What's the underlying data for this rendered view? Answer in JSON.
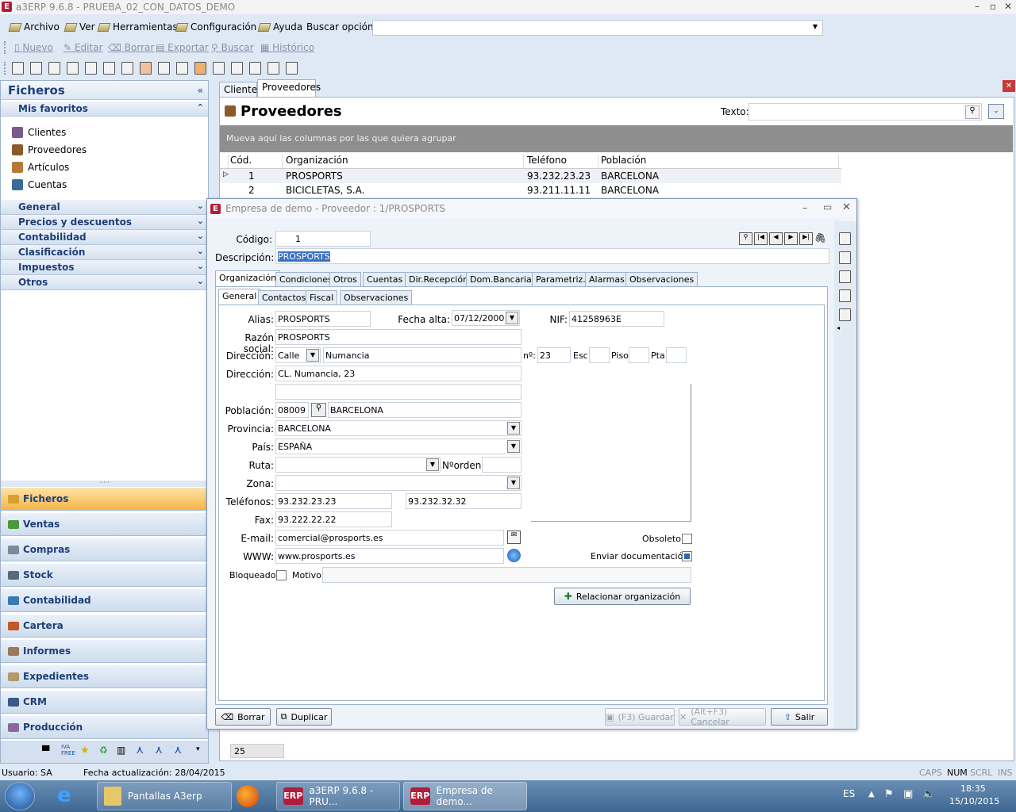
{
  "window": {
    "title": "a3ERP 9.6.8 - PRUEBA_02_CON_DATOS_DEMO",
    "icon": "E"
  },
  "menu": {
    "items": [
      "Archivo",
      "Ver",
      "Herramientas",
      "Configuración",
      "Ayuda"
    ],
    "search_label": "Buscar opción:"
  },
  "toolbar": {
    "nuevo": "Nuevo",
    "editar": "Editar",
    "borrar": "Borrar",
    "exportar": "Exportar",
    "buscar": "Buscar",
    "historico": "Histórico"
  },
  "left": {
    "title": "Ficheros",
    "favorites_title": "Mis favoritos",
    "favorites": [
      "Clientes",
      "Proveedores",
      "Artículos",
      "Cuentas"
    ],
    "sections": [
      "General",
      "Precios y descuentos",
      "Contabilidad",
      "Clasificación",
      "Impuestos",
      "Otros"
    ],
    "modules": [
      "Ficheros",
      "Ventas",
      "Compras",
      "Stock",
      "Contabilidad",
      "Cartera",
      "Informes",
      "Expedientes",
      "CRM",
      "Producción"
    ]
  },
  "main": {
    "tabs": [
      "Clientes",
      "Proveedores"
    ],
    "title": "Proveedores",
    "texto_label": "Texto:",
    "group_hint": "Mueva aquí las columnas por las que quiera agrupar",
    "columns": [
      "Cód. prov",
      "Organización",
      "Teléfono",
      "Población"
    ],
    "rows": [
      [
        "1",
        "PROSPORTS",
        "93.232.23.23",
        "BARCELONA"
      ],
      [
        "2",
        "BICICLETAS, S.A.",
        "93.211.11.11",
        "BARCELONA"
      ]
    ],
    "count": "25"
  },
  "dialog": {
    "title": "Empresa de demo - Proveedor : 1/PROSPORTS",
    "codigo_label": "Código:",
    "codigo": "1",
    "descripcion_label": "Descripción:",
    "descripcion": "PROSPORTS",
    "tabs": [
      "Organización",
      "Condiciones",
      "Otros",
      "Cuentas",
      "Dir.Recepción",
      "Dom.Bancarias",
      "Parametriz.",
      "Alarmas",
      "Observaciones"
    ],
    "subtabs": [
      "General",
      "Contactos",
      "Fiscal",
      "Observaciones"
    ],
    "alias_label": "Alias:",
    "alias": "PROSPORTS",
    "fecha_label": "Fecha alta:",
    "fecha": "07/12/2000",
    "nif_label": "NIF:",
    "nif": "41258963E",
    "razon_label": "Razón social:",
    "razon": "PROSPORTS",
    "direccion_label": "Dirección:",
    "via": "Calle",
    "calle": "Numancia",
    "num_label": "nº:",
    "num": "23",
    "esc_label": "Esc",
    "piso_label": "Piso",
    "pta_label": "Pta",
    "direccion2_label": "Dirección:",
    "direccion2": "CL. Numancia, 23",
    "poblacion_label": "Población:",
    "cp": "08009",
    "poblacion": "BARCELONA",
    "provincia_label": "Provincia:",
    "provincia": "BARCELONA",
    "pais_label": "País:",
    "pais": "ESPAÑA",
    "ruta_label": "Ruta:",
    "norden_label": "Nºorden:",
    "zona_label": "Zona:",
    "telefonos_label": "Teléfonos:",
    "tel1": "93.232.23.23",
    "tel2": "93.232.32.32",
    "fax_label": "Fax:",
    "fax": "93.222.22.22",
    "email_label": "E-mail:",
    "email": "comercial@prosports.es",
    "www_label": "WWW:",
    "www": "www.prosports.es",
    "obsoleto_label": "Obsoleto",
    "enviar_label": "Enviar documentación",
    "bloqueado_label": "Bloqueado",
    "motivo_label": "Motivo:",
    "relacionar": "Relacionar organización",
    "borrar": "Borrar",
    "duplicar": "Duplicar",
    "guardar": "(F3) Guardar",
    "cancelar": "(Alt+F3) Cancelar",
    "salir": "Salir"
  },
  "status": {
    "usuario": "Usuario: SA",
    "fecha": "Fecha actualización: 28/04/2015",
    "caps": "CAPS",
    "num": "NUM",
    "scrl": "SCRL",
    "ins": "INS"
  },
  "taskbar": {
    "items": [
      "Pantallas A3erp",
      "a3ERP 9.6.8 - PRU...",
      "Empresa de demo..."
    ],
    "lang": "ES",
    "time": "18:35",
    "date": "15/10/2015",
    "erp": "ERP"
  }
}
